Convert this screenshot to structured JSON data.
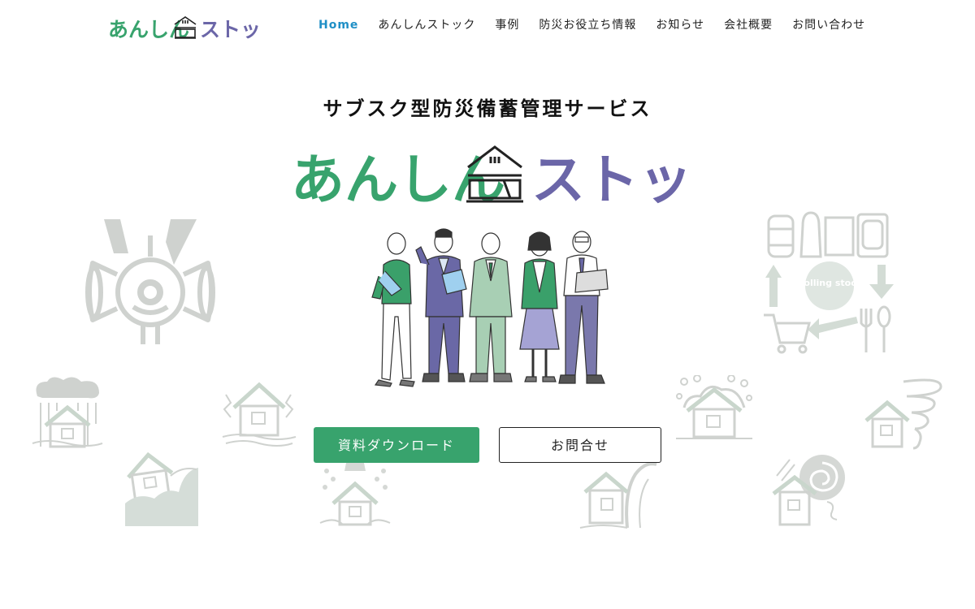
{
  "header": {
    "logo_text": "あんしんストック",
    "nav": [
      {
        "label": "Home",
        "active": true
      },
      {
        "label": "あんしんストック"
      },
      {
        "label": "事例"
      },
      {
        "label": "防災お役立ち情報"
      },
      {
        "label": "お知らせ"
      },
      {
        "label": "会社概要"
      },
      {
        "label": "お問い合わせ"
      }
    ]
  },
  "hero": {
    "tagline": "サブスク型防災備蓄管理サービス",
    "logo_text_green": "あんしん",
    "logo_text_purple": "ストック",
    "rolling_stock_badge": "Rolling stock",
    "buttons": {
      "download": "資料ダウンロード",
      "contact": "お問合せ"
    }
  },
  "colors": {
    "brand_green": "#38a36d",
    "brand_purple": "#6b66a8",
    "nav_active": "#1f8fc6",
    "illustration_gray": "#c8ccc9"
  },
  "icons": [
    "siren-icon",
    "flood-rain-house-icon",
    "earthquake-house-icon",
    "landslide-house-icon",
    "volcano-house-icon",
    "tsunami-house-icon",
    "snow-house-icon",
    "tornado-house-icon",
    "typhoon-house-icon",
    "rolling-stock-cycle-icon",
    "people-illustration"
  ]
}
